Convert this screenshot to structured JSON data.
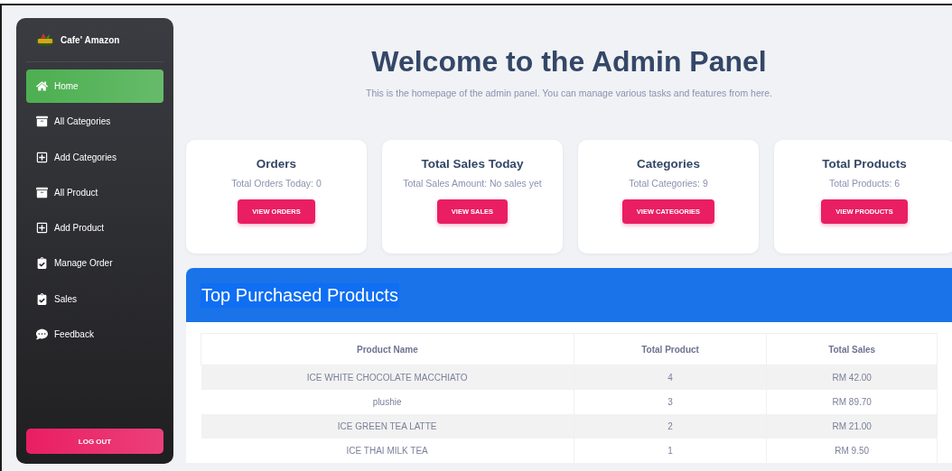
{
  "sidebar": {
    "brand": "Cafe' Amazon",
    "items": [
      {
        "label": "Home",
        "kind": "home",
        "selected": true
      },
      {
        "label": "All Categories",
        "kind": "box",
        "selected": false
      },
      {
        "label": "Add Categories",
        "kind": "plus",
        "selected": false
      },
      {
        "label": "All Product",
        "kind": "box",
        "selected": false
      },
      {
        "label": "Add Product",
        "kind": "plus",
        "selected": false
      },
      {
        "label": "Manage Order",
        "kind": "clipboard",
        "selected": false
      },
      {
        "label": "Sales",
        "kind": "clipboard",
        "selected": false
      },
      {
        "label": "Feedback",
        "kind": "comment",
        "selected": false
      }
    ],
    "logout": "LOG OUT"
  },
  "header": {
    "title": "Welcome to the Admin Panel",
    "subtitle": "This is the homepage of the admin panel. You can manage various tasks and features from here."
  },
  "cards": [
    {
      "title": "Orders",
      "text": "Total Orders Today: 0",
      "button": "VIEW ORDERS"
    },
    {
      "title": "Total Sales Today",
      "text": "Total Sales Amount: No sales yet",
      "button": "VIEW SALES"
    },
    {
      "title": "Categories",
      "text": "Total Categories: 9",
      "button": "VIEW CATEGORIES"
    },
    {
      "title": "Total Products",
      "text": "Total Products: 6",
      "button": "VIEW PRODUCTS"
    }
  ],
  "top_products": {
    "title": "Top Purchased Products",
    "columns": [
      "Product Name",
      "Total Product",
      "Total Sales"
    ],
    "rows": [
      [
        "ICE WHITE CHOCOLATE MACCHIATO",
        "4",
        "RM 42.00"
      ],
      [
        "plushie",
        "3",
        "RM 89.70"
      ],
      [
        "ICE GREEN TEA LATTE",
        "2",
        "RM 21.00"
      ],
      [
        "ICE THAI MILK TEA",
        "1",
        "RM 9.50"
      ]
    ]
  }
}
